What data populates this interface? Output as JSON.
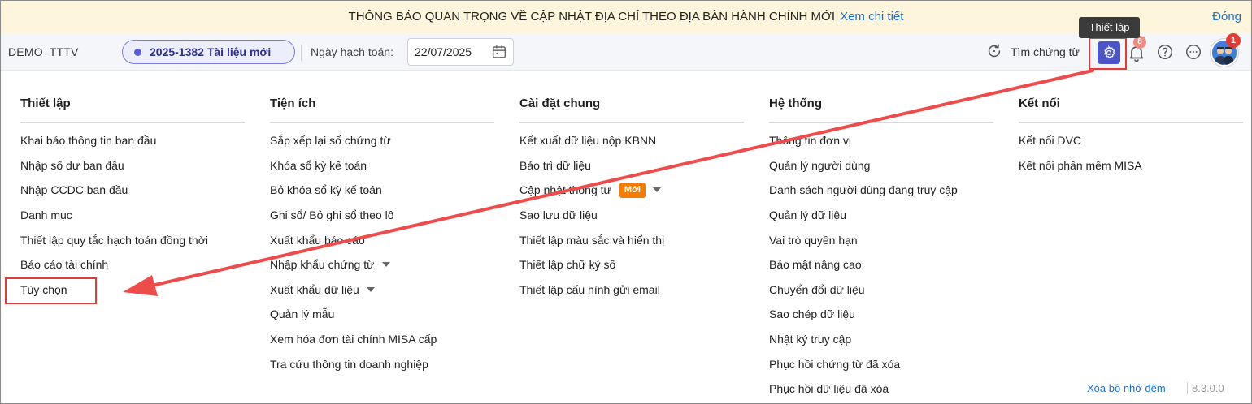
{
  "banner": {
    "message": "THÔNG BÁO QUAN TRỌNG VỀ CẬP NHẬT ĐỊA CHỈ THEO ĐỊA BÀN HÀNH CHÍNH MỚI",
    "link": "Xem chi tiết",
    "close": "Đóng"
  },
  "header": {
    "company": "DEMO_TTTV",
    "database": "2025-1382 Tài liệu mới",
    "date_label": "Ngày hạch toán:",
    "date_value": "22/07/2025",
    "search_label": "Tìm chứng từ",
    "tooltip": "Thiết lập",
    "bell_badge": "8",
    "avatar_badge": "1"
  },
  "columns": [
    {
      "title": "Thiết lập",
      "items": [
        {
          "label": "Khai báo thông tin ban đầu"
        },
        {
          "label": "Nhập số dư ban đầu"
        },
        {
          "label": "Nhập CCDC ban đầu"
        },
        {
          "label": "Danh mục"
        },
        {
          "label": "Thiết lập quy tắc hạch toán đồng thời"
        },
        {
          "label": "Báo cáo tài chính"
        },
        {
          "label": "Tùy chọn"
        }
      ]
    },
    {
      "title": "Tiện ích",
      "items": [
        {
          "label": "Sắp xếp lại số chứng từ"
        },
        {
          "label": "Khóa sổ kỳ kế toán"
        },
        {
          "label": "Bỏ khóa sổ kỳ kế toán"
        },
        {
          "label": "Ghi sổ/ Bỏ ghi sổ theo lô"
        },
        {
          "label": "Xuất khẩu báo cáo"
        },
        {
          "label": "Nhập khẩu chứng từ",
          "caret": true
        },
        {
          "label": "Xuất khẩu dữ liệu",
          "caret": true
        },
        {
          "label": "Quản lý mẫu"
        },
        {
          "label": "Xem hóa đơn tài chính MISA cấp"
        },
        {
          "label": "Tra cứu thông tin doanh nghiệp"
        }
      ]
    },
    {
      "title": "Cài đặt chung",
      "items": [
        {
          "label": "Kết xuất dữ liệu nộp KBNN"
        },
        {
          "label": "Bảo trì dữ liệu"
        },
        {
          "label": "Cập nhật thông tư",
          "badge": "Mới",
          "caret": true
        },
        {
          "label": "Sao lưu dữ liệu"
        },
        {
          "label": "Thiết lập màu sắc và hiển thị"
        },
        {
          "label": "Thiết lập chữ ký số"
        },
        {
          "label": "Thiết lập cấu hình gửi email"
        }
      ]
    },
    {
      "title": "Hệ thống",
      "items": [
        {
          "label": "Thông tin đơn vị"
        },
        {
          "label": "Quản lý người dùng"
        },
        {
          "label": "Danh sách người dùng đang truy cập"
        },
        {
          "label": "Quản lý dữ liệu"
        },
        {
          "label": "Vai trò quyền hạn"
        },
        {
          "label": "Bảo mật nâng cao"
        },
        {
          "label": "Chuyển đổi dữ liệu"
        },
        {
          "label": "Sao chép dữ liệu"
        },
        {
          "label": "Nhật ký truy cập"
        },
        {
          "label": "Phục hồi chứng từ đã xóa"
        },
        {
          "label": "Phục hồi dữ liệu đã xóa"
        }
      ]
    },
    {
      "title": "Kết nối",
      "items": [
        {
          "label": "Kết nối DVC"
        },
        {
          "label": "Kết nối phần mềm MISA"
        }
      ]
    }
  ],
  "footer": {
    "clear_cache": "Xóa bộ nhớ đệm",
    "version": "8.3.0.0"
  },
  "colors": {
    "accent": "#4b55c7",
    "highlight": "#e53935",
    "link": "#1f6fd1",
    "new_badge": "#f57c00",
    "banner_bg": "#fdf6dc"
  }
}
